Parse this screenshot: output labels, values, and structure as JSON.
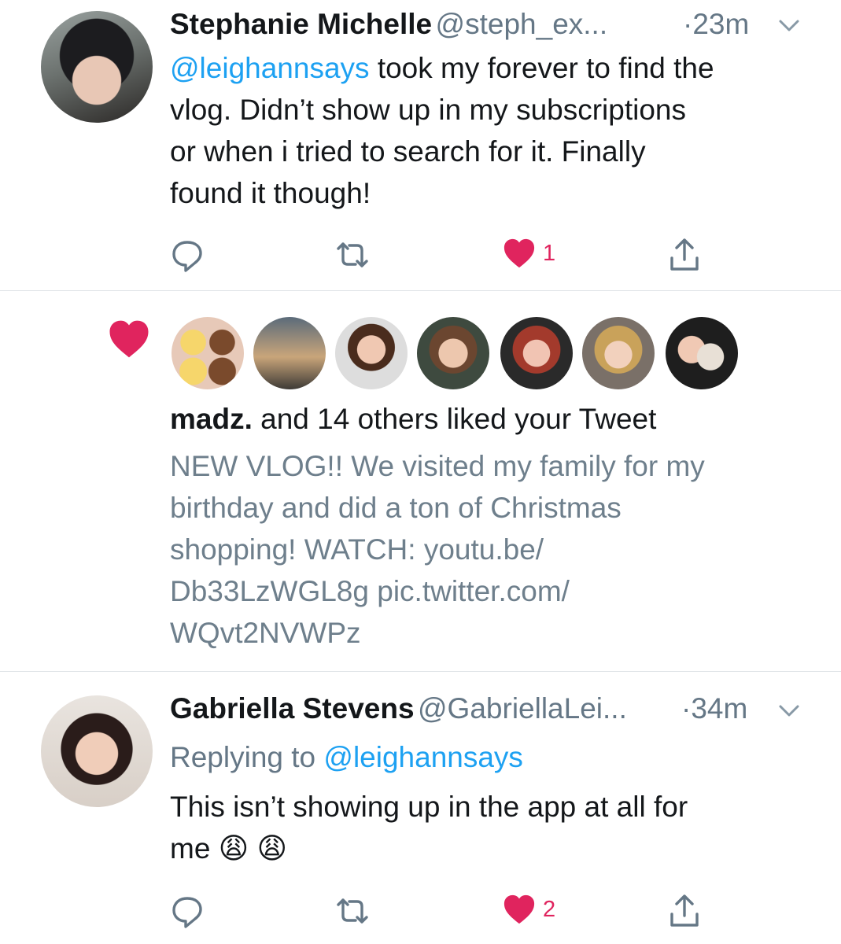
{
  "tweets": [
    {
      "name": "Stephanie Michelle",
      "handle": "@steph_ex...",
      "time": "·23m",
      "lines": [
        {
          "mention": "@leighannsays",
          "text": " took my forever to find the"
        },
        {
          "text": "vlog. Didn’t show up in my subscriptions"
        },
        {
          "text": "or when i tried to search for it. Finally"
        },
        {
          "text": "found it though!"
        }
      ],
      "likes": "1"
    },
    {
      "name": "Gabriella Stevens",
      "handle": "@GabriellaLei...",
      "time": "·34m",
      "replying_prefix": "Replying to ",
      "replying_handle": "@leighannsays",
      "lines": [
        {
          "text": "This isn’t showing up in the app at all for"
        },
        {
          "text": "me 😩 😩"
        }
      ],
      "likes": "2"
    }
  ],
  "like_notification": {
    "actor": "madz.",
    "summary": " and 14 others liked your Tweet",
    "tweet_lines": [
      "NEW VLOG!! We visited my family for my",
      "birthday and did a ton of Christmas",
      "shopping! WATCH: youtu.be/",
      "Db33LzWGL8g pic.twitter.com/",
      "WQvt2NVWPz"
    ]
  },
  "colors": {
    "like_red": "#e0245e",
    "link_blue": "#1da1f2",
    "muted_gray": "#657786",
    "divider": "#dfe3e6"
  },
  "icons": [
    "reply-icon",
    "retweet-icon",
    "heart-icon",
    "share-icon",
    "chevron-down-icon"
  ]
}
